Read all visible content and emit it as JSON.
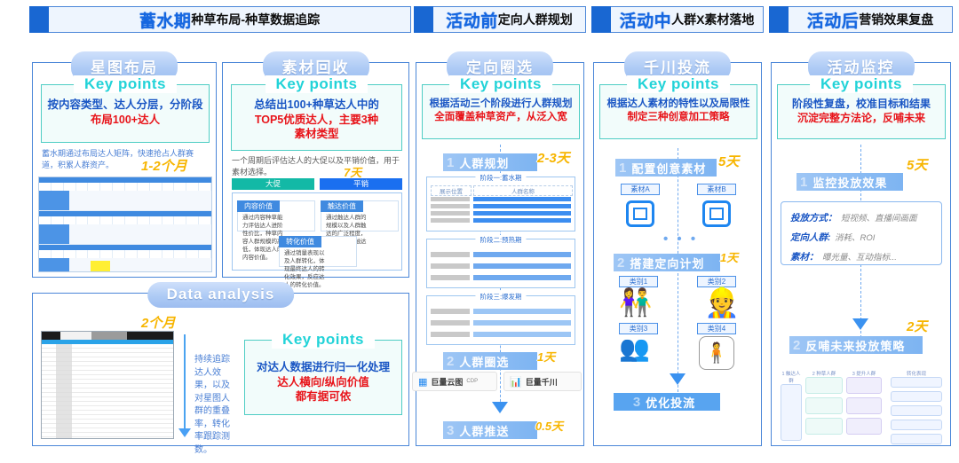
{
  "columns": [
    {
      "id": "c1",
      "highlight": "蓄水期",
      "sub": "种草布局-种草数据追踪"
    },
    {
      "id": "c2",
      "highlight": "活动前",
      "sub": "定向人群规划"
    },
    {
      "id": "c3",
      "highlight": "活动中",
      "sub": "人群X素材落地"
    },
    {
      "id": "c4",
      "highlight": "活动后",
      "sub": "营销效果复盘"
    }
  ],
  "panels": {
    "xingtu": {
      "title": "星图布局",
      "key_title": "Key points",
      "key_line1": "按内容类型、达人分层，分阶段",
      "key_line2": "布局100+达人",
      "note": "蓄水期通过布局达人矩阵，快速抢占人群赛道，积累人群资产。",
      "duration": "1-2个月"
    },
    "sucai": {
      "title": "素材回收",
      "key_title": "Key points",
      "key_line1": "总结出100+种草达人中的",
      "key_line2": "TOP5优质达人，主要3种",
      "key_line3": "素材类型",
      "note": "一个周期后评估达人的大促以及平销价值，用于素材选择。",
      "duration": "7天",
      "tab_a": "大促",
      "tab_b": "平销",
      "value_cards": [
        {
          "title": "内容价值",
          "text": "通过内容种草能力评估达人进阶性价比，种草内容人群规模的高低，体现达人的内容价值。"
        },
        {
          "title": "触达价值",
          "text": "通过触达人群的规模以及人群触达的广泛程度，体现达人的触达价值。"
        },
        {
          "title": "转化价值",
          "text": "通过销量表现以及人群转化，体现最终达人的转化效果，反应达人的转化价值。"
        }
      ]
    },
    "data_analysis": {
      "title": "Data analysis",
      "duration": "2个月",
      "note": "持续追踪达人效果，以及对星图人群的重叠率，转化率跟踪测数。",
      "key_title": "Key points",
      "key_line1": "对达人数据进行归一化处理",
      "key_line2": "达人横向/纵向价值",
      "key_line3": "都有据可依"
    },
    "quanxuan": {
      "title": "定向圈选",
      "key_title": "Key points",
      "key_line1": "根据活动三个阶段进行人群规划",
      "key_line2": "全面覆盖种草资产，从泛入宽",
      "step1": {
        "num": "1",
        "label": "人群规划",
        "duration": "2-3天"
      },
      "step2": {
        "num": "2",
        "label": "人群圈选",
        "duration": "1天"
      },
      "step3": {
        "num": "3",
        "label": "人群推送",
        "duration": "0.5天"
      },
      "stages": [
        {
          "title": "阶段一:蓄水期",
          "col_a": "展示位置",
          "col_b": "人群名称",
          "rows": 4
        },
        {
          "title": "阶段二:预热期",
          "col_a": "",
          "col_b": "",
          "rows": 3
        },
        {
          "title": "阶段三:爆发期",
          "col_a": "",
          "col_b": "",
          "rows": 3
        }
      ],
      "logo_left": "巨量云图",
      "logo_left_sub": "CDP",
      "logo_right": "巨量千川"
    },
    "qianchuan": {
      "title": "千川投流",
      "key_title": "Key points",
      "key_line1": "根据达人素材的特性以及局限性",
      "key_line2": "制定三种创意加工策略",
      "step1": {
        "num": "1",
        "label": "配置创意素材",
        "duration": "5天"
      },
      "step2": {
        "num": "2",
        "label": "搭建定向计划",
        "duration": "1天"
      },
      "step3": {
        "num": "3",
        "label": "优化投流",
        "duration": ""
      },
      "material_a": "素材A",
      "material_b": "素材B",
      "ellipsis": "• • •",
      "categories": [
        "类别1",
        "类别2",
        "类别3",
        "类别4"
      ]
    },
    "jiankong": {
      "title": "活动监控",
      "key_title": "Key points",
      "key_line1": "阶段性复盘，校准目标和结果",
      "key_line2": "沉淀完整方法论，反哺未来",
      "step1": {
        "num": "1",
        "label": "监控投放效果",
        "duration": "5天"
      },
      "step2": {
        "num": "2",
        "label": "反哺未来投放策略",
        "duration": "2天"
      },
      "metrics": [
        {
          "label": "投放方式：",
          "value": "短视频、直播间画面"
        },
        {
          "label": "定向人群:",
          "value": "消耗、ROI"
        },
        {
          "label": "素材：",
          "value": "曝光量、互动指标..."
        }
      ],
      "funnel_headers": [
        "1 触达人群",
        "2 种草人群",
        "3 提升人群",
        "转化表现"
      ]
    }
  },
  "colors": {
    "brand_blue": "#1667e0",
    "accent_cyan": "#22d3d8",
    "alert_red": "#e8141a",
    "duration_gold": "#f7b500",
    "panel_border": "#4a86d8"
  }
}
